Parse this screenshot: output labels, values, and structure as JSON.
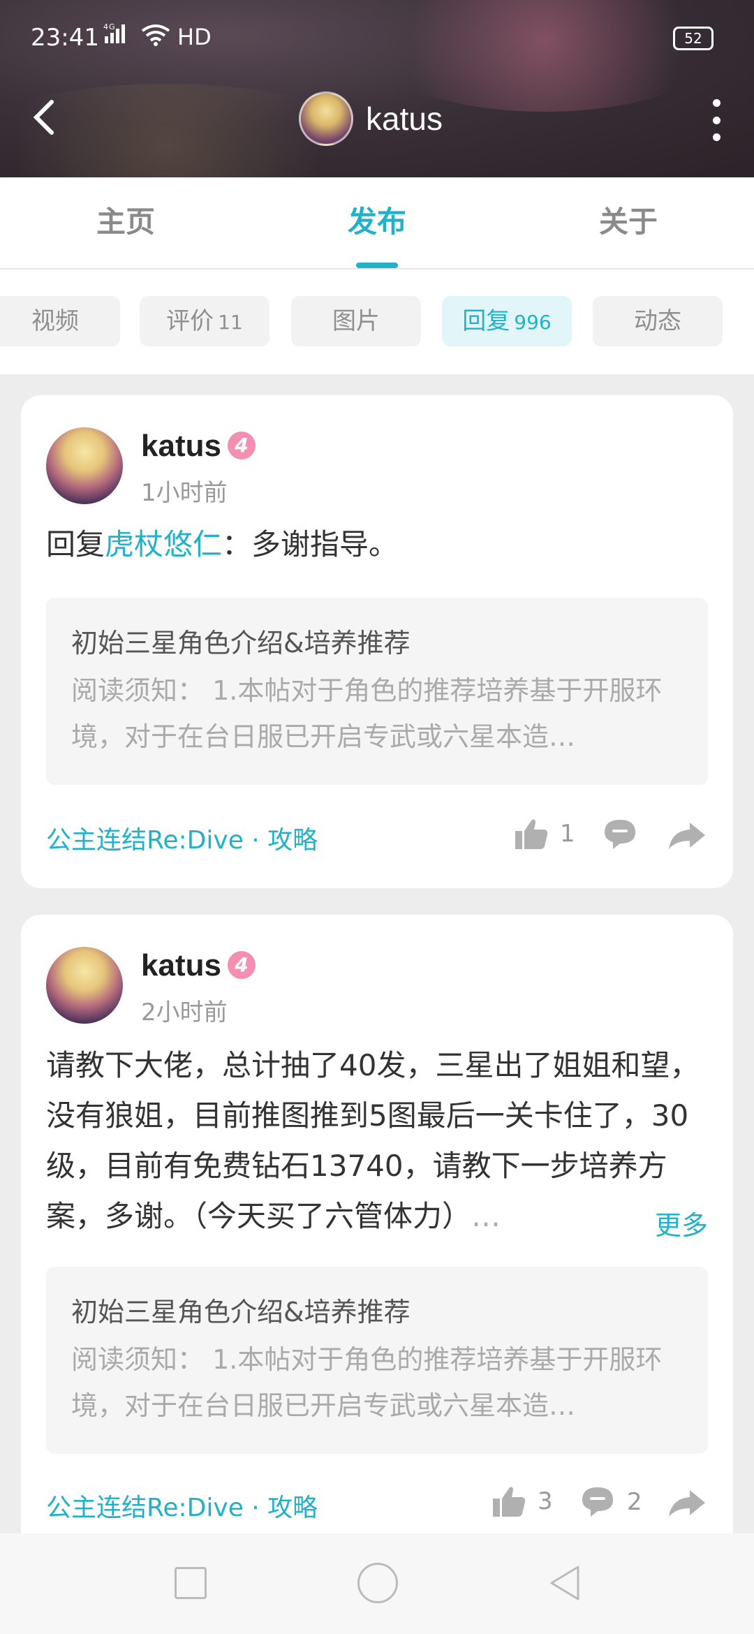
{
  "status": {
    "time": "23:41",
    "signal": "4G",
    "network": "HD",
    "battery": "52"
  },
  "header": {
    "title": "katus"
  },
  "tabs": [
    {
      "label": "主页",
      "active": false
    },
    {
      "label": "发布",
      "active": true
    },
    {
      "label": "关于",
      "active": false
    }
  ],
  "chips": [
    {
      "label": "视频",
      "count": ""
    },
    {
      "label": "评价",
      "count": "11"
    },
    {
      "label": "图片",
      "count": ""
    },
    {
      "label": "回复",
      "count": "996"
    },
    {
      "label": "动态",
      "count": ""
    }
  ],
  "posts": [
    {
      "author": "katus",
      "level": "4",
      "time": "1小时前",
      "prefix": "回复",
      "mention": "虎杖悠仁",
      "text": "：多谢指导。",
      "quote_title": "初始三星角色介绍&培养推荐",
      "quote_desc": "阅读须知： 1.本帖对于角色的推荐培养基于开服环境，对于在台日服已开启专武或六星本造…",
      "tag": "公主连结Re:Dive · 攻略",
      "likes": "1",
      "comments": ""
    },
    {
      "author": "katus",
      "level": "4",
      "time": "2小时前",
      "text": "请教下大佬，总计抽了40发，三星出了姐姐和望，没有狼姐，目前推图推到5图最后一关卡住了，30级，目前有免费钻石13740，请教下一步培养方案，多谢。（今天买了六管体力）",
      "ellipsis": "…",
      "more": "更多",
      "quote_title": "初始三星角色介绍&培养推荐",
      "quote_desc": "阅读须知： 1.本帖对于角色的推荐培养基于开服环境，对于在台日服已开启专武或六星本造…",
      "tag": "公主连结Re:Dive · 攻略",
      "likes": "3",
      "comments": "2"
    }
  ],
  "colors": {
    "accent": "#1fb2c8",
    "level_badge": "#f48fb1",
    "background": "#ededed"
  },
  "icons": [
    "back-icon",
    "more-vert-icon",
    "thumb-up-icon",
    "comment-icon",
    "share-icon",
    "nav-square-icon",
    "nav-circle-icon",
    "nav-back-icon"
  ]
}
